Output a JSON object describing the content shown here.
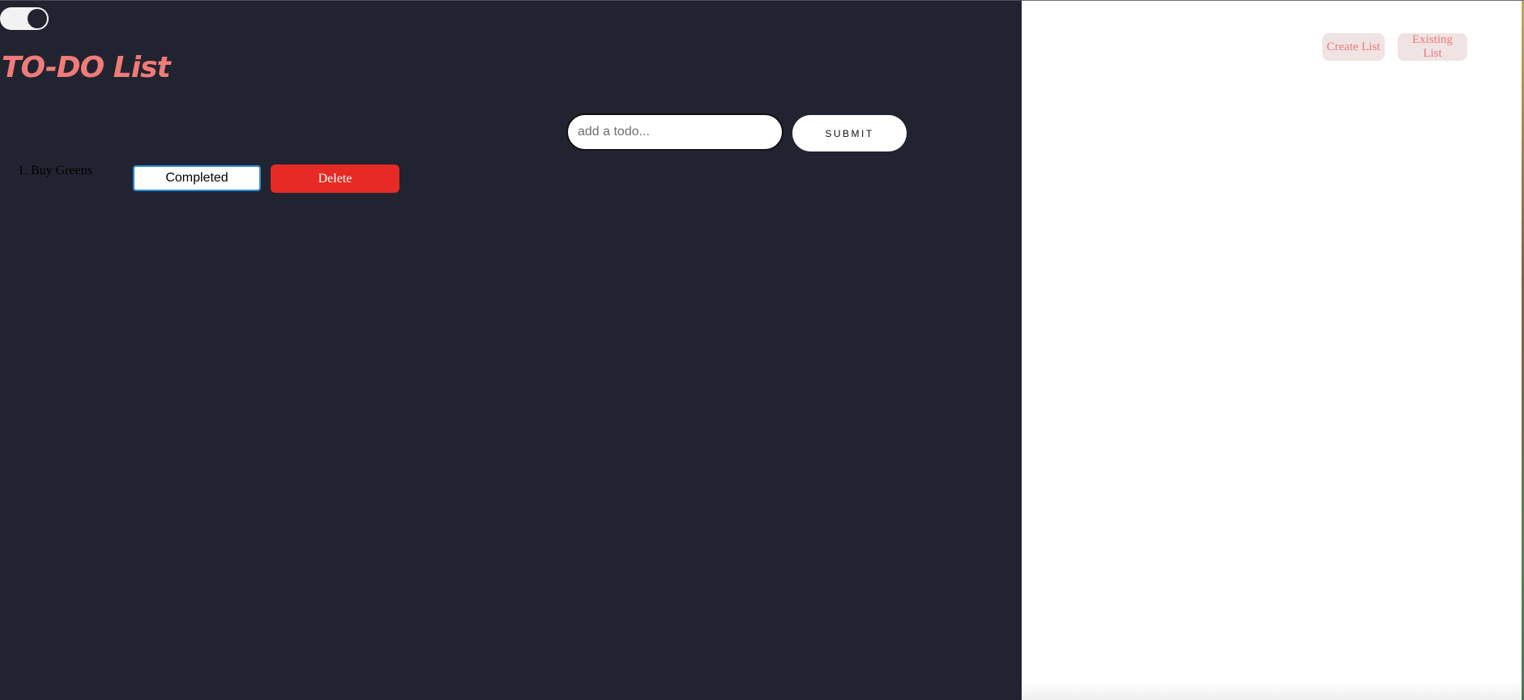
{
  "app": {
    "title": "TO-DO List"
  },
  "theme_toggle": {
    "state": "dark"
  },
  "form": {
    "input_value": "",
    "input_placeholder": "add a todo...",
    "submit_label": "SUBMIT"
  },
  "todos": [
    {
      "number": "1.",
      "text": "Buy Greens",
      "display": "1. Buy Greens",
      "completed_label": "Completed",
      "delete_label": "Delete"
    }
  ],
  "nav": {
    "create_label": "Create List",
    "existing_label": "Existing List"
  },
  "colors": {
    "dark_background": "#212430",
    "title_accent": "#f07b78",
    "delete_red": "#e62a25",
    "completed_border": "#2b8ad8",
    "nav_button_bg": "#efe4e3",
    "nav_button_text": "#ec7a78"
  }
}
